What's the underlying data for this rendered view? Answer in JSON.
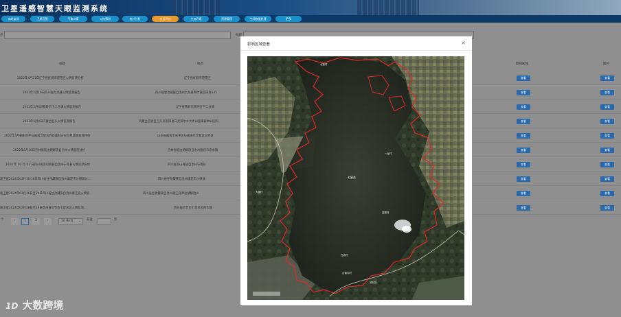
{
  "header": {
    "title": "卫星遥感智慧天眼监测系统"
  },
  "nav": {
    "items": [
      {
        "label": "实时监测"
      },
      {
        "label": "卫星云图"
      },
      {
        "label": "气象详情"
      },
      {
        "label": "火险预测"
      },
      {
        "label": "统计分析"
      },
      {
        "label": "灾后评估"
      },
      {
        "label": "生态环境"
      },
      {
        "label": "资源管理"
      },
      {
        "label": "空间数据处理"
      },
      {
        "label": "更多"
      }
    ],
    "active_index": 5
  },
  "search": {
    "left_label": "点",
    "right_label": "标题"
  },
  "table": {
    "headers": {
      "title": "标题",
      "location": "地点",
      "area": "影响区域",
      "image": "图片"
    },
    "view_label": "查看",
    "rows": [
      {
        "title": "2022年4月23日辽宁省抚顺市望花区火情监测分析",
        "location": "辽宁省抚顺市望花区"
      },
      {
        "title": "2022年2月16日四川省九龙县火情监测报告",
        "location": "四川省甘孜藏族自治州九龙县呷尔镇吉日寺545"
      },
      {
        "title": "2022年5月4日铁岭市下二台镇火情监测报告",
        "location": "辽宁省铁岭市清河区下二台镇"
      },
      {
        "title": "2022年5月4日内蒙古包头火情监测报告",
        "location": "内蒙古自治区包头市固阳县白灵淖尔乡大青山国家森林公园内"
      },
      {
        "title": "2022年4月朝阳市平与威海文登交界处森林火灾卫星遥感监测评估",
        "location": "山东省威海市牟平区与威海市文登区交界处"
      },
      {
        "title": "2022年5月10日吉林省延边朝鲜族自治州火情监测分析",
        "location": "吉林省延边朝鲜族自治州图们市凉水镇"
      },
      {
        "title": "2024 年 03 月 02 日四川省凉山彝族自治州宁南县火情监测分析",
        "location": "四川省凉山彝族自治州宁南县"
      },
      {
        "title": "遥卫星2024年03月16-18日四川省甘孜藏族自治州康定市沙德镇火...",
        "location": "四川省甘孜藏族自治州康定市沙德镇"
      },
      {
        "title": "遥卫星2024年03月16日至24日四川省甘孜藏族自治州雅江县火情监...",
        "location": "四川省甘孜藏族自治州雅江县呷拉镇解放乡"
      },
      {
        "title": "遥卫星2024年02月18日至19日贵州省毕节市七星关区火情监测...",
        "location": "贵州省毕节市七星关区阿市镇"
      }
    ]
  },
  "pager": {
    "total_prefix": "个",
    "pages": [
      "1",
      "2"
    ],
    "current": "1",
    "page_size": "10 条/页",
    "goto_prefix": "前往",
    "goto_suffix": "页"
  },
  "modal": {
    "title": "影响区域查看",
    "close_label": "×",
    "map_labels": [
      "北窑村",
      "七星关",
      "一龙村",
      "大营村",
      "高寨村",
      "白岩村",
      "吉普沟村",
      "某村庄"
    ]
  },
  "watermark": {
    "text": "大数跨境",
    "mark": "1D"
  },
  "colors": {
    "nav_button": "#1a8fc9",
    "nav_active": "#e89a2c",
    "view_button": "#2b69a8",
    "burn_outline": "#e0282a"
  }
}
